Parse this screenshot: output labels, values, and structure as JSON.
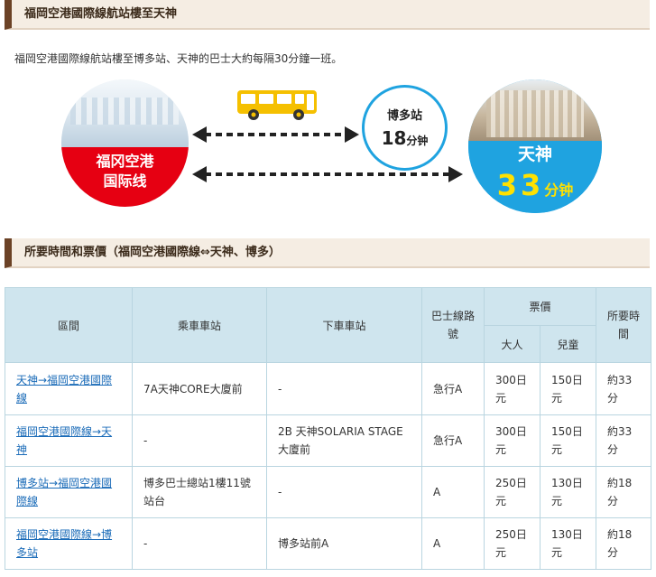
{
  "section1": {
    "title": "福岡空港國際線航站樓至天神"
  },
  "intro": "福岡空港國際線航站樓至博多站、天神的巴士大約每隔30分鐘一班。",
  "diagram": {
    "airport": {
      "line1": "福冈空港",
      "line2": "国际线"
    },
    "hakata": {
      "name": "博多站",
      "minutes": "18",
      "unit": "分钟"
    },
    "tenjin": {
      "name": "天神",
      "minutes": "33",
      "unit": "分钟"
    },
    "bus_color": "#f5c000",
    "airport_color": "#e60012",
    "tenjin_color": "#1fa3e0"
  },
  "section2": {
    "title": "所要時間和票價（福岡空港國際線⇔天神、博多）"
  },
  "table": {
    "headers": {
      "section": "區間",
      "board": "乘車車站",
      "alight": "下車車站",
      "route": "巴士線路號",
      "fare": "票價",
      "adult": "大人",
      "child": "兒童",
      "time": "所要時間"
    },
    "rows": [
      {
        "section": "天神→福岡空港國際線",
        "board": "7A天神CORE大廈前",
        "alight": "-",
        "route": "急行A",
        "adult": "300日元",
        "child": "150日元",
        "time": "約33分"
      },
      {
        "section": "福岡空港國際線→天神",
        "board": "-",
        "alight": "2B 天神SOLARIA STAGE大廈前",
        "route": "急行A",
        "adult": "300日元",
        "child": "150日元",
        "time": "約33分"
      },
      {
        "section": "博多站→福岡空港國際線",
        "board": "博多巴士總站1樓11號站台",
        "alight": "-",
        "route": "A",
        "adult": "250日元",
        "child": "130日元",
        "time": "約18分"
      },
      {
        "section": "福岡空港國際線→博多站",
        "board": "-",
        "alight": "博多站前A",
        "route": "A",
        "adult": "250日元",
        "child": "130日元",
        "time": "約18分"
      }
    ]
  }
}
